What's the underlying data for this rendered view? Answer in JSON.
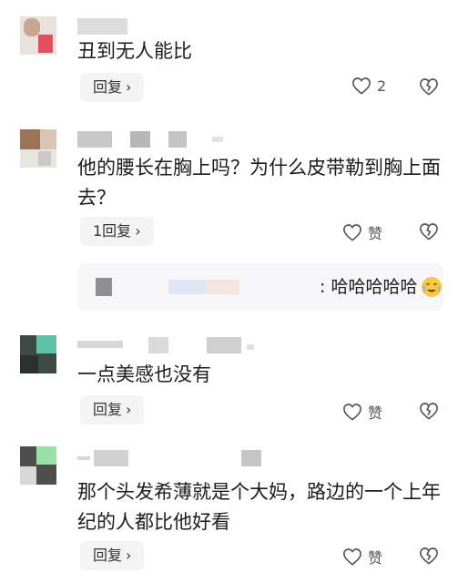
{
  "comments": [
    {
      "text": "丑到无人能比",
      "reply_label": "回复",
      "like_count": "2",
      "icons": {
        "like": "heart-icon",
        "dislike": "broken-heart-icon",
        "reply": "chevron-right-icon"
      }
    },
    {
      "text": "他的腰长在胸上吗？为什么皮带勒到胸上面去？",
      "reply_label": "1回复",
      "like_label": "赞",
      "icons": {
        "like": "heart-icon",
        "dislike": "broken-heart-icon",
        "reply": "chevron-right-icon"
      },
      "sub_reply": {
        "text": ": 哈哈哈哈哈",
        "emoji": "crying-face-emoji"
      }
    },
    {
      "text": "一点美感也没有",
      "reply_label": "回复",
      "like_label": "赞",
      "icons": {
        "like": "heart-icon",
        "dislike": "broken-heart-icon",
        "reply": "chevron-right-icon"
      }
    },
    {
      "text": "那个头发希薄就是个大妈，路边的一个上年纪的人都比他好看",
      "reply_label": "回复",
      "like_label": "赞",
      "icons": {
        "like": "heart-icon",
        "dislike": "broken-heart-icon",
        "reply": "chevron-right-icon"
      }
    }
  ],
  "colors": {
    "text": "#1c1c1c",
    "icon": "#555555",
    "reply_bg": "#f4f4f5",
    "subreply_bg": "#f7f7f9",
    "blur_gray": "#cfcfcf"
  }
}
